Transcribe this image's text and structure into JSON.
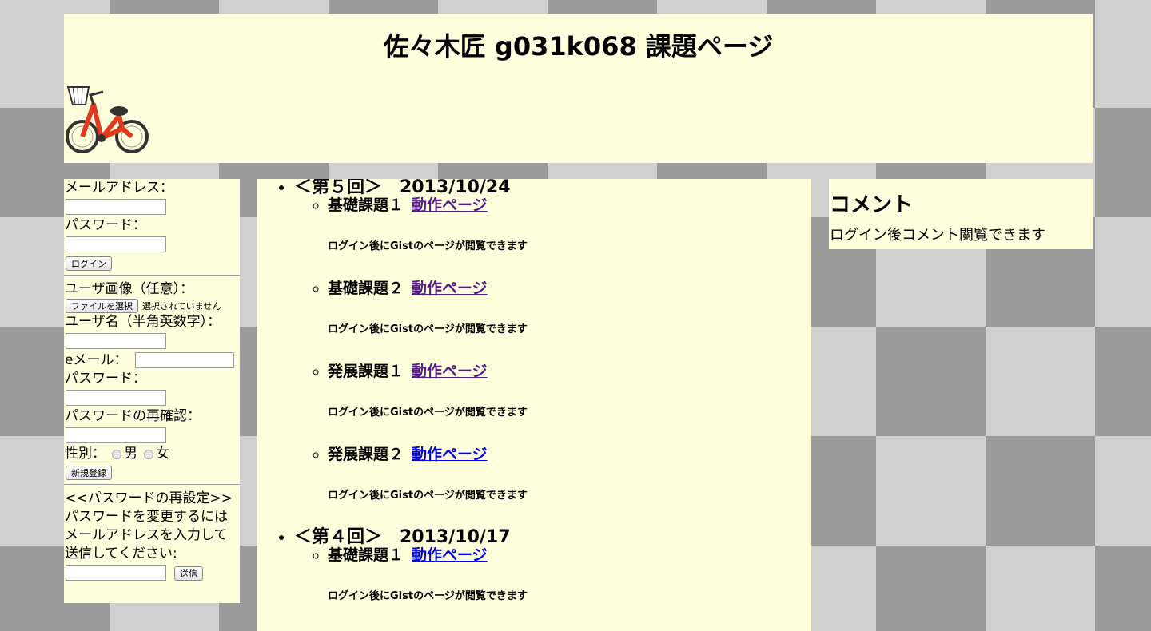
{
  "header": {
    "title": "佐々木匠 g031k068 課題ページ"
  },
  "login": {
    "email_label": "メールアドレス：",
    "password_label": "パスワード：",
    "login_button": "ログイン"
  },
  "register": {
    "image_label": "ユーザ画像（任意）：",
    "file_button": "ファイルを選択",
    "file_status": "選択されていません",
    "username_label": "ユーザ名（半角英数字）：",
    "email_label": "eメール：",
    "password_label": "パスワード：",
    "password_confirm_label": "パスワードの再確認：",
    "gender_label": "性別：",
    "gender_male": "男",
    "gender_female": "女",
    "submit_button": "新規登録"
  },
  "reset": {
    "title": "<<パスワードの再設定>>",
    "line1": "パスワードを変更するには",
    "line2": "メールアドレスを入力して",
    "line3": "送信してください:",
    "send_button": "送信"
  },
  "weeks": [
    {
      "heading": "＜第５回＞　2013/10/24",
      "tasks": [
        {
          "title": "基礎課題１",
          "link": "動作ページ",
          "note": "ログイン後にGistのページが閲覧できます"
        },
        {
          "title": "基礎課題２",
          "link": "動作ページ",
          "note": "ログイン後にGistのページが閲覧できます"
        },
        {
          "title": "発展課題１",
          "link": "動作ページ",
          "note": "ログイン後にGistのページが閲覧できます"
        },
        {
          "title": "発展課題２",
          "link": "動作ページ",
          "note": "ログイン後にGistのページが閲覧できます"
        }
      ]
    },
    {
      "heading": "＜第４回＞　2013/10/17",
      "tasks": [
        {
          "title": "基礎課題１",
          "link": "動作ページ",
          "note": "ログイン後にGistのページが閲覧できます"
        }
      ]
    }
  ],
  "comments": {
    "title": "コメント",
    "message": "ログイン後コメント閲覧できます"
  },
  "colors": {
    "panel": "#ffffdd",
    "link": "#0000ee",
    "visited_link": "#551a8b"
  }
}
